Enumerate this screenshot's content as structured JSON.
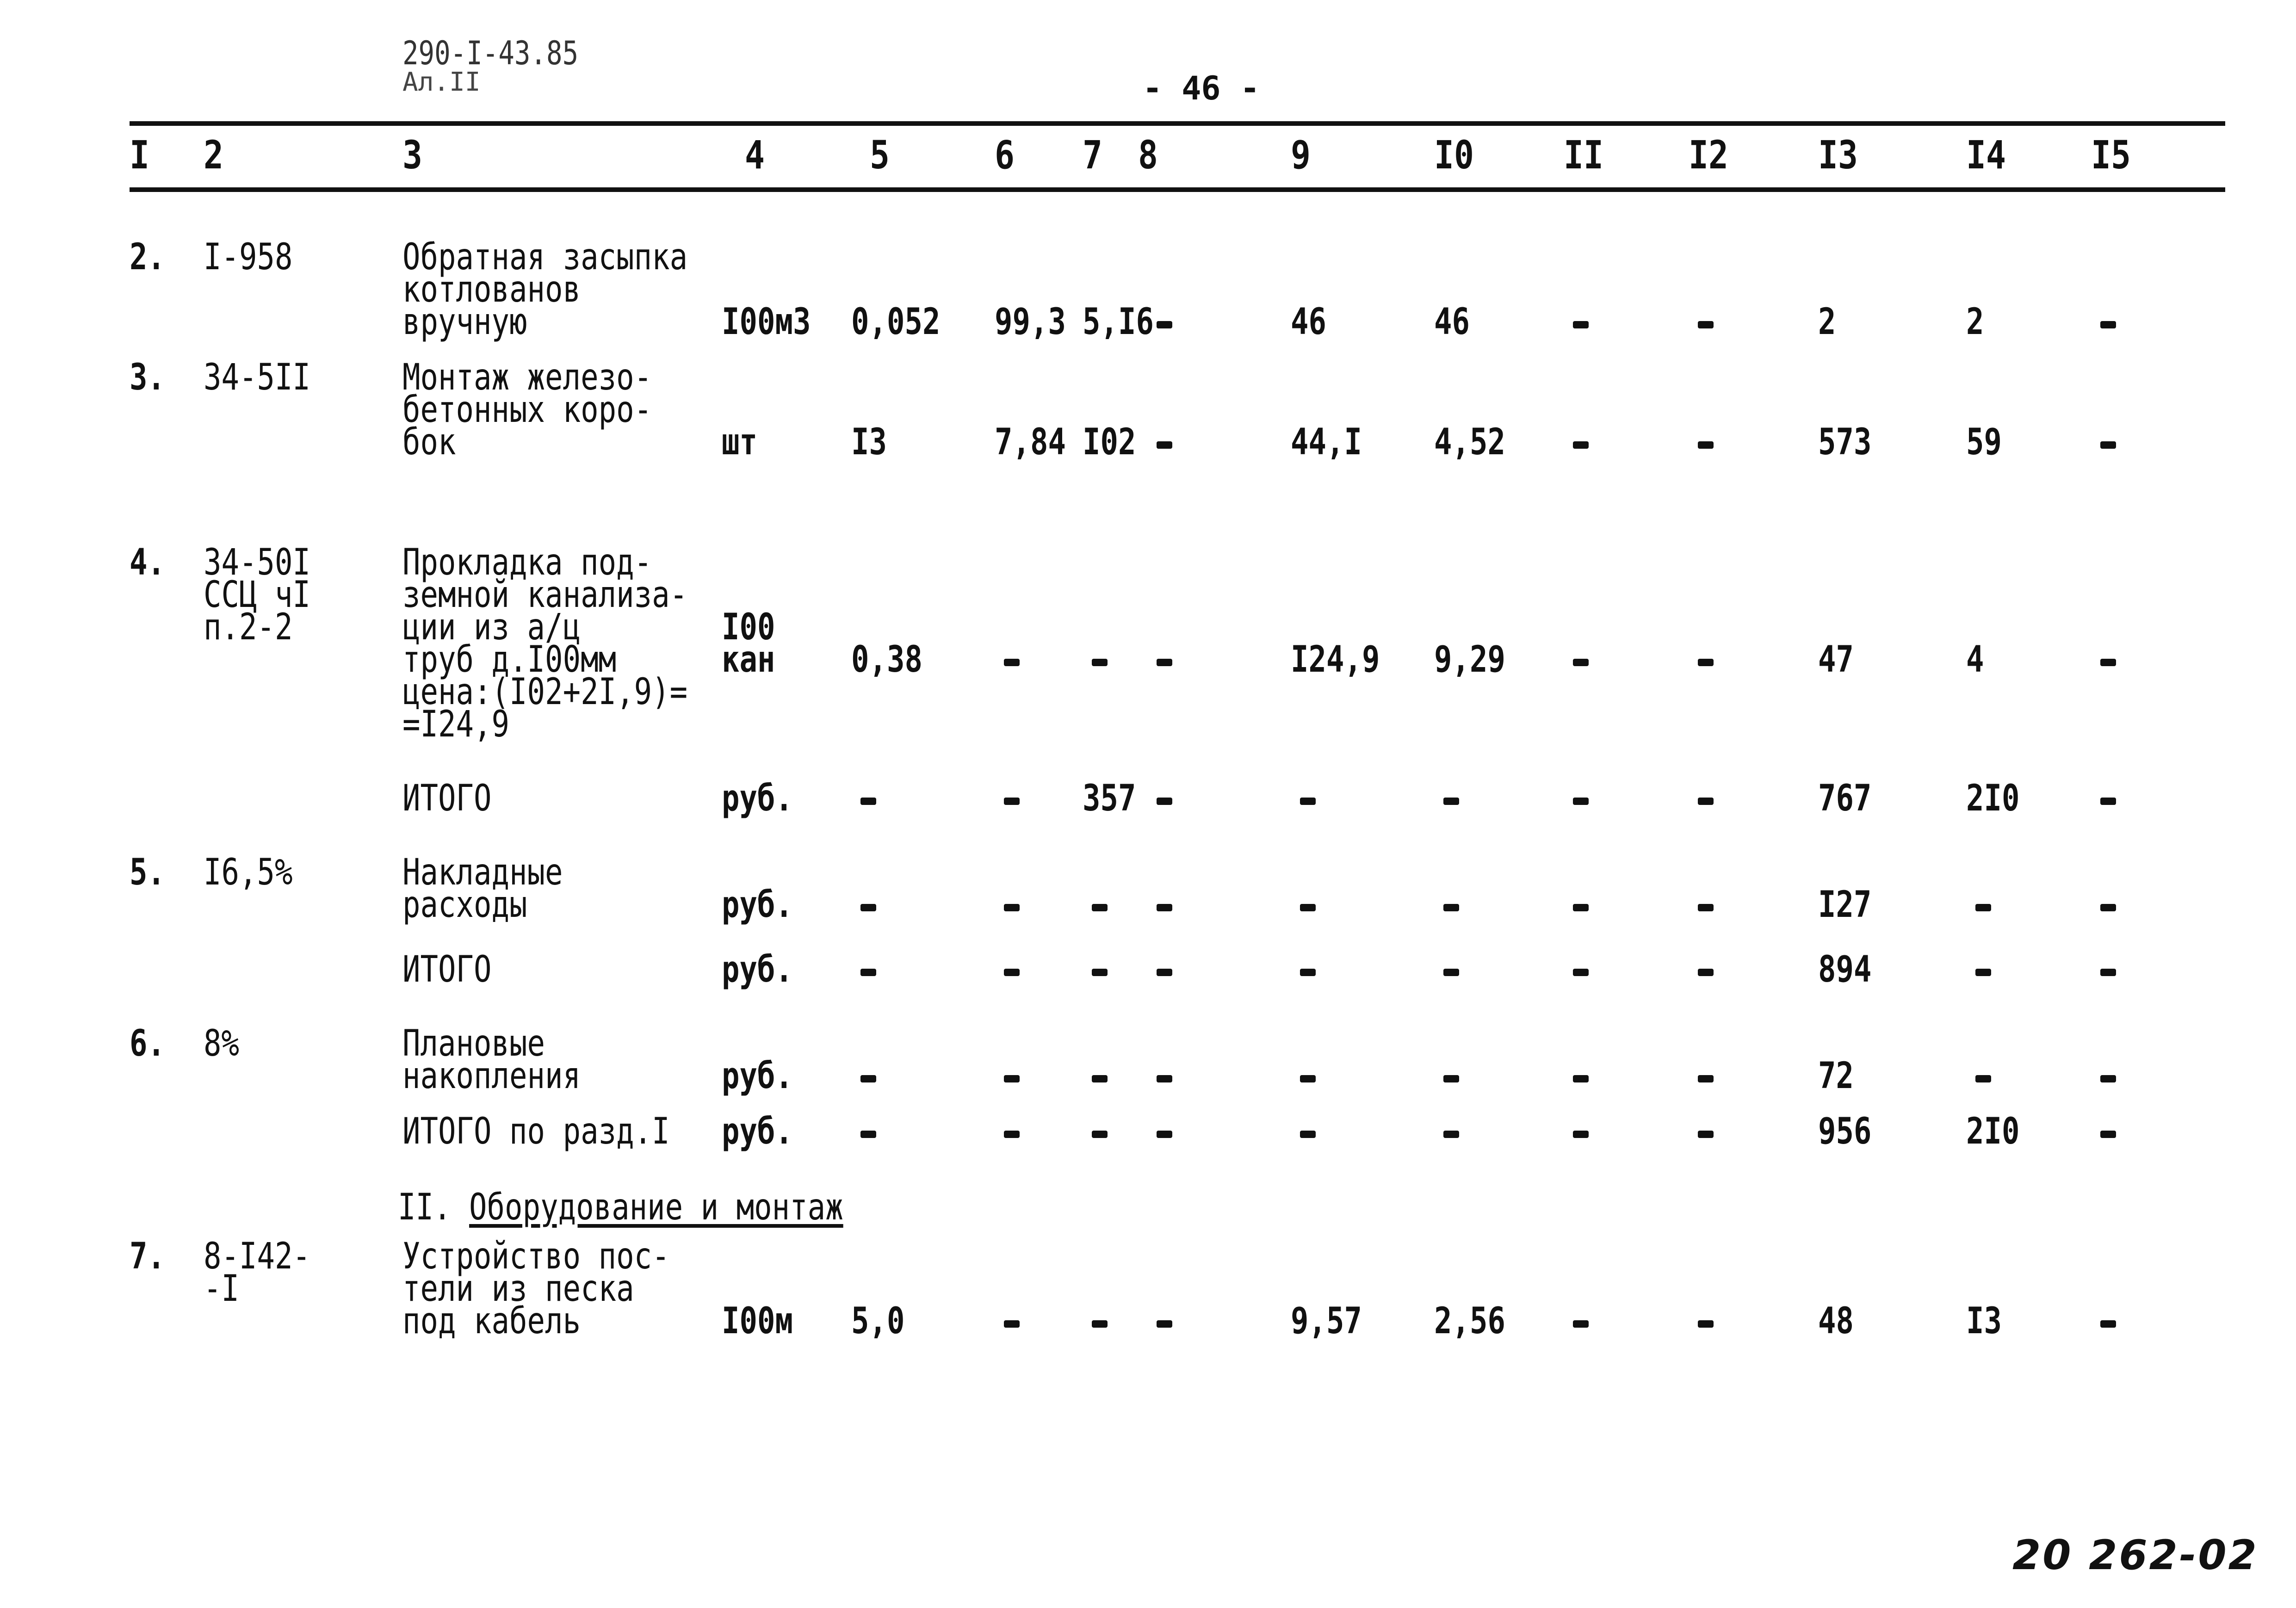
{
  "document": {
    "code": "290-I-43.85",
    "sheet": "Ал.II",
    "page_number": "- 46 -",
    "stamp": "20 262-02"
  },
  "table": {
    "column_headers": [
      "I",
      "2",
      "3",
      "4",
      "5",
      "6",
      "7",
      "8",
      "9",
      "I0",
      "II",
      "I2",
      "I3",
      "I4",
      "I5"
    ],
    "rows": [
      {
        "num": "2.",
        "code": [
          "I-958"
        ],
        "description": [
          "Обратная засыпка",
          "котлованов",
          "вручную"
        ],
        "unit": [
          "I00м3"
        ],
        "qty": "0,052",
        "c6": "99,3",
        "c7": "5,I6",
        "c8": "-",
        "c9": "46",
        "c10": "46",
        "c11": "-",
        "c12": "-",
        "c13": "2",
        "c14": "2",
        "c15": "-"
      },
      {
        "num": "3.",
        "code": [
          "34-5II"
        ],
        "description": [
          "Монтаж железо-",
          "бетонных коро-",
          "бок"
        ],
        "unit": [
          "шт"
        ],
        "qty": "I3",
        "c6": "7,84",
        "c7": "I02",
        "c8": "-",
        "c9": "44,I",
        "c10": "4,52",
        "c11": "-",
        "c12": "-",
        "c13": "573",
        "c14": "59",
        "c15": "-"
      },
      {
        "num": "4.",
        "code": [
          "34-50I",
          "ССЦ чI",
          "п.2-2"
        ],
        "description": [
          "Прокладка под-",
          "земной канализа-",
          "ции из а/ц",
          "труб д.I00мм",
          "цена:(I02+2I,9)=",
          "=I24,9"
        ],
        "unit": [
          "I00",
          "кан"
        ],
        "qty": "0,38",
        "c6": "-",
        "c7": "-",
        "c8": "-",
        "c9": "I24,9",
        "c10": "9,29",
        "c11": "-",
        "c12": "-",
        "c13": "47",
        "c14": "4",
        "c15": "-"
      },
      {
        "num": "",
        "code": [],
        "description": [
          "ИТОГО"
        ],
        "unit": [
          "руб."
        ],
        "qty": "-",
        "c6": "-",
        "c7": "357",
        "c8": "-",
        "c9": "-",
        "c10": "-",
        "c11": "-",
        "c12": "-",
        "c13": "767",
        "c14": "2I0",
        "c15": "-"
      },
      {
        "num": "5.",
        "code": [
          "I6,5%"
        ],
        "description": [
          "Накладные",
          "расходы"
        ],
        "unit": [
          "руб."
        ],
        "qty": "-",
        "c6": "-",
        "c7": "-",
        "c8": "-",
        "c9": "-",
        "c10": "-",
        "c11": "-",
        "c12": "-",
        "c13": "I27",
        "c14": "-",
        "c15": "-"
      },
      {
        "num": "",
        "code": [],
        "description": [
          "ИТОГО"
        ],
        "unit": [
          "руб."
        ],
        "qty": "-",
        "c6": "-",
        "c7": "-",
        "c8": "-",
        "c9": "-",
        "c10": "-",
        "c11": "-",
        "c12": "-",
        "c13": "894",
        "c14": "-",
        "c15": "-"
      },
      {
        "num": "6.",
        "code": [
          "8%"
        ],
        "description": [
          "Плановые",
          "накопления"
        ],
        "unit": [
          "руб."
        ],
        "qty": "-",
        "c6": "-",
        "c7": "-",
        "c8": "-",
        "c9": "-",
        "c10": "-",
        "c11": "-",
        "c12": "-",
        "c13": "72",
        "c14": "-",
        "c15": "-"
      },
      {
        "num": "",
        "code": [],
        "description": [
          "ИТОГО по разд.I"
        ],
        "unit": [
          "руб."
        ],
        "qty": "-",
        "c6": "-",
        "c7": "-",
        "c8": "-",
        "c9": "-",
        "c10": "-",
        "c11": "-",
        "c12": "-",
        "c13": "956",
        "c14": "2I0",
        "c15": "-"
      },
      {
        "num": "7.",
        "code": [
          "8-I42-",
          "-I"
        ],
        "description": [
          "Устройство пос-",
          "тели из песка",
          "под кабель"
        ],
        "unit": [
          "I00м"
        ],
        "qty": "5,0",
        "c6": "-",
        "c7": "-",
        "c8": "-",
        "c9": "9,57",
        "c10": "2,56",
        "c11": "-",
        "c12": "-",
        "c13": "48",
        "c14": "I3",
        "c15": "-"
      }
    ]
  },
  "section_2": {
    "prefix": "II.",
    "title": "Оборудование и монтаж"
  }
}
